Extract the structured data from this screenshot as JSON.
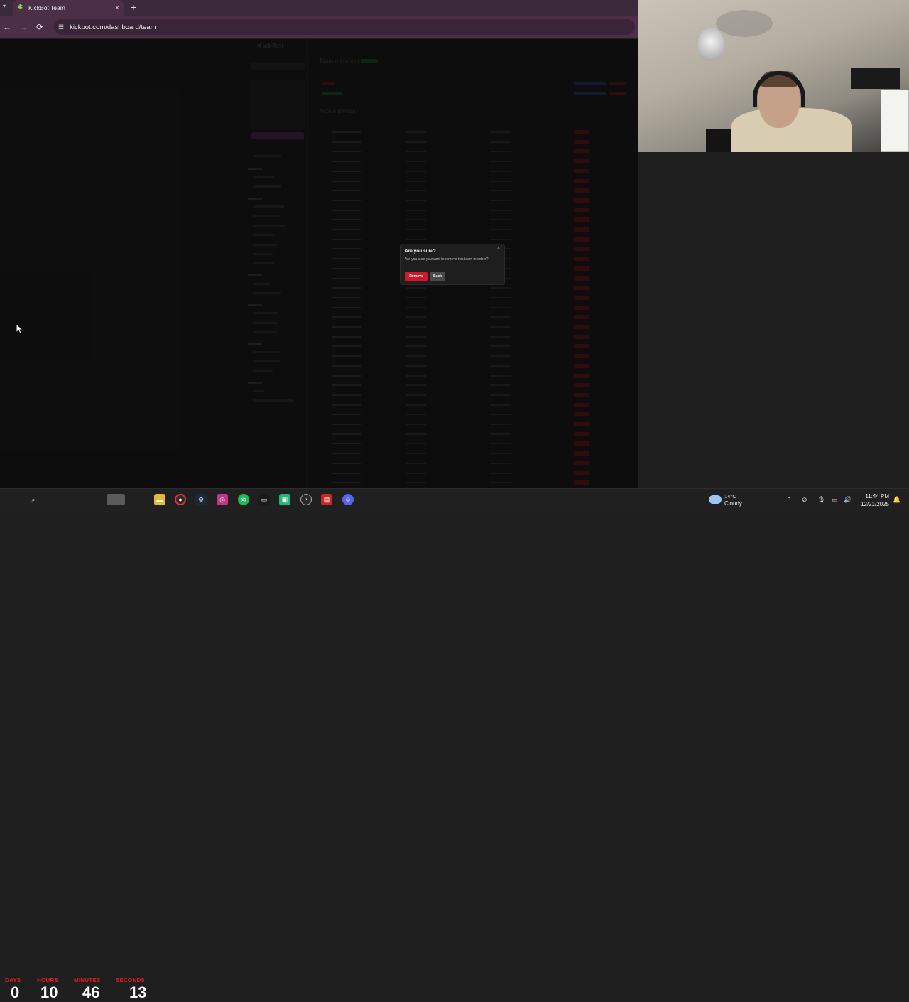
{
  "browser": {
    "tab_title": "KickBot Team",
    "tab_close": "×",
    "new_tab": "+",
    "url": "kickbot.com/dashboard/team",
    "back": "←",
    "forward": "→",
    "reload": "⟳"
  },
  "app": {
    "logo": "KickBot",
    "team_members_heading": "Team members",
    "active_invites_heading": "Active Invites"
  },
  "modal": {
    "title": "Are you sure?",
    "message": "Are you sure you want to remove this team member?",
    "close": "×",
    "remove_label": "Remove",
    "back_label": "Back"
  },
  "timer": {
    "days_label": "DAYS",
    "hours_label": "HOURS",
    "minutes_label": "MINUTES",
    "seconds_label": "SECONDS",
    "days": "0",
    "hours": "10",
    "minutes": "46",
    "seconds": "13"
  },
  "taskbar": {
    "weather_temp": "14°C",
    "weather_desc": "Cloudy",
    "time": "11:44 PM",
    "date": "12/21/2025"
  },
  "colors": {
    "accent_remove": "#d0182c",
    "timer_label": "#e01b24",
    "browser_chrome": "#4a2f46"
  }
}
